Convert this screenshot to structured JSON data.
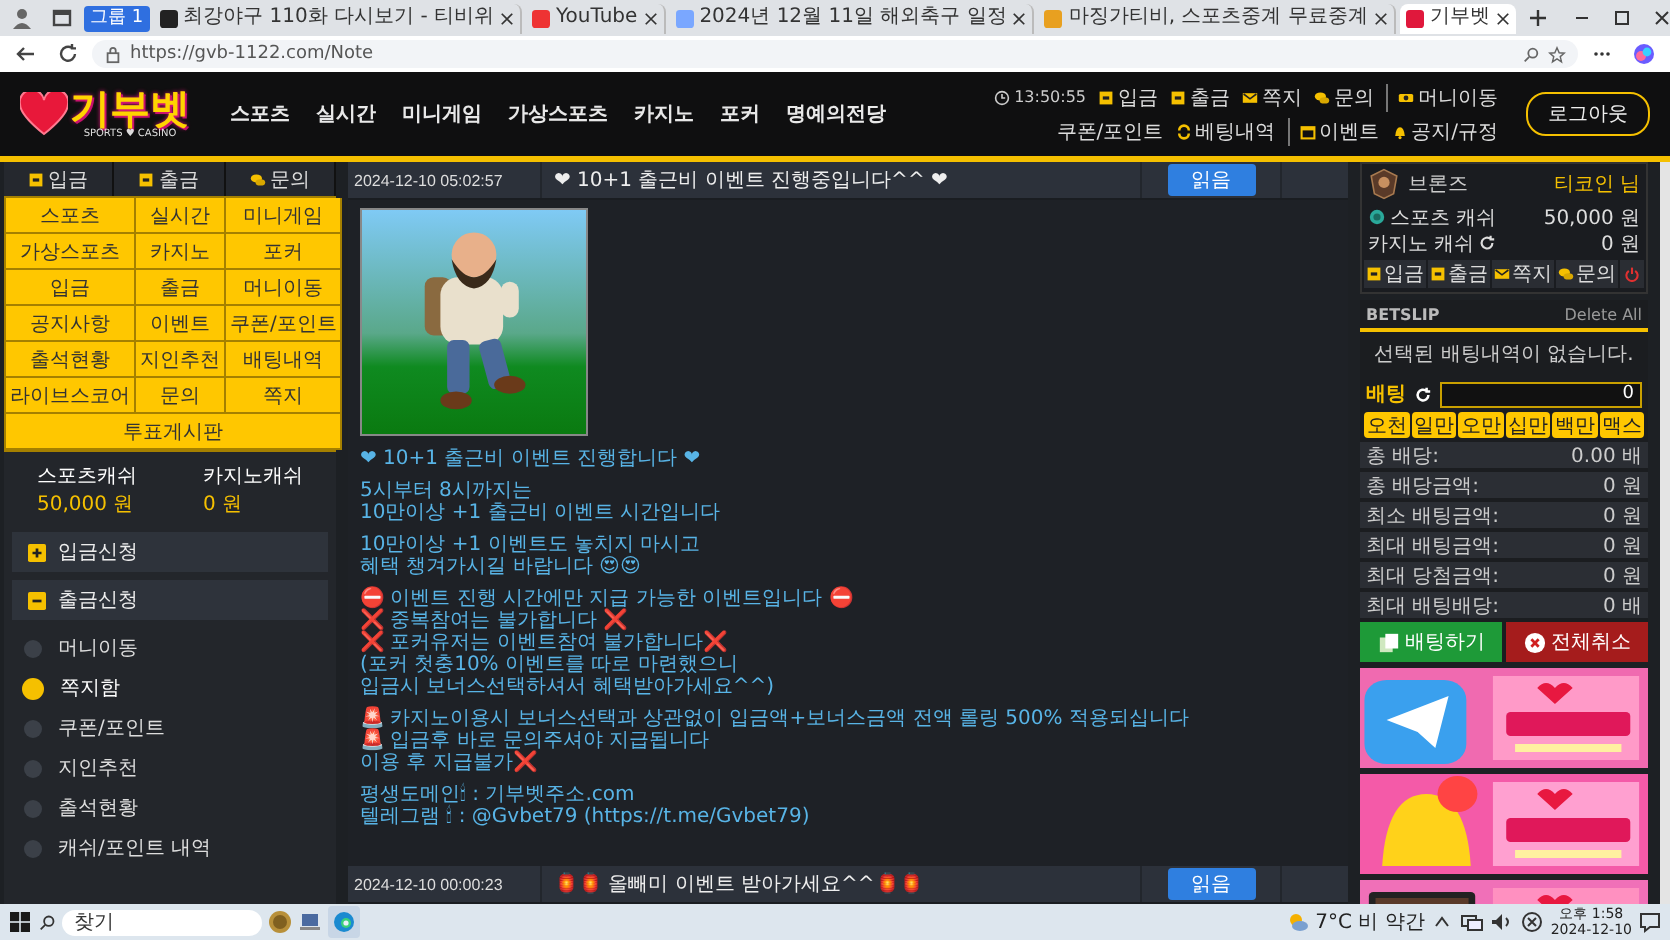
{
  "browser": {
    "group": "그룹 1",
    "tabs": [
      {
        "title": "최강야구 110화 다시보기 - 티비위",
        "selected": false
      },
      {
        "title": "YouTube",
        "selected": false
      },
      {
        "title": "2024년 12월 11일 해외축구 일정",
        "selected": false
      },
      {
        "title": "마징가티비, 스포츠중계 무료중계",
        "selected": false
      },
      {
        "title": "기부벳",
        "selected": true
      }
    ],
    "url": "https://gvb-1122.com/Note"
  },
  "header": {
    "logo": "기부벳",
    "tagline": "SPORTS ♥ CASINO",
    "nav": [
      "스포츠",
      "실시간",
      "미니게임",
      "가상스포츠",
      "카지노",
      "포커",
      "명예의전당"
    ],
    "time": "13:50:55",
    "utility": [
      "입금",
      "출금",
      "쪽지",
      "문의",
      "머니이동",
      "쿠폰/포인트",
      "베팅내역",
      "이벤트",
      "공지/규정"
    ],
    "logout": "로그아웃"
  },
  "sidebar": {
    "quick": [
      "입금",
      "출금",
      "문의"
    ],
    "grid": [
      "스포츠",
      "실시간",
      "미니게임",
      "가상스포츠",
      "카지노",
      "포커",
      "입금",
      "출금",
      "머니이동",
      "공지사항",
      "이벤트",
      "쿠폰/포인트",
      "출석현황",
      "지인추천",
      "배팅내역",
      "라이브스코어",
      "문의",
      "쪽지",
      "투표게시판"
    ],
    "cash": [
      {
        "label": "스포츠캐쉬",
        "amount": "50,000 원"
      },
      {
        "label": "카지노캐쉬",
        "amount": "0 원"
      }
    ],
    "sections": [
      {
        "label": "입금신청",
        "expanded": false
      },
      {
        "label": "출금신청",
        "expanded": true,
        "children": [
          {
            "label": "머니이동",
            "selected": false
          },
          {
            "label": "쪽지함",
            "selected": true
          },
          {
            "label": "쿠폰/포인트",
            "selected": false
          },
          {
            "label": "지인추천",
            "selected": false
          },
          {
            "label": "출석현황",
            "selected": false
          },
          {
            "label": "캐쉬/포인트 내역",
            "selected": false
          }
        ]
      }
    ]
  },
  "notes": [
    {
      "date": "2024-12-10 05:02:57",
      "title": "❤ 10+1 출근비 이벤트 진행중입니다^^ ❤",
      "button": "읽음",
      "expanded": true,
      "image": {
        "kind": "picture"
      },
      "paragraphs": [
        [
          "❤ 10+1 출근비 이벤트 진행합니다 ❤"
        ],
        [
          "5시부터 8시까지는",
          "10만이상 +1 출근비 이벤트 시간입니다"
        ],
        [
          "10만이상 +1 이벤트도 놓치지 마시고",
          "혜택 챙겨가시길 바랍니다 😍😍"
        ],
        [
          "⛔ 이벤트 진행 시간에만 지급 가능한 이벤트입니다 ⛔",
          "❌ 중복참여는 불가합니다 ❌",
          "❌ 포커유저는 이벤트참여 불가합니다❌",
          "(포커 첫충10% 이벤트를 따로 마련했으니",
          "입금시 보너스선택하셔서 혜택받아가세요^^)"
        ],
        [
          "🚨 카지노이용시 보너스선택과 상관없이 입금액+보너스금액 전액 롤링 500% 적용되십니다",
          "🚨 입금후 바로 문의주셔야 지급됩니다",
          "이용 후 지급불가❌"
        ],
        [
          "평생도메인🕯 : 기부벳주소.com",
          "텔레그램 🕯 : @Gvbet79 (https://t.me/Gvbet79)"
        ]
      ]
    },
    {
      "date": "2024-12-10 00:00:23",
      "title": "🏮🏮 올빼미 이벤트 받아가세요^^🏮🏮",
      "button": "읽음",
      "expanded": false
    }
  ],
  "account": {
    "rank": "브론즈",
    "user": "티코인 님",
    "cash": [
      {
        "label": "스포츠 캐쉬",
        "amount": "50,000 원"
      },
      {
        "label": "카지노 캐쉬",
        "amount": "0 원"
      }
    ],
    "buttons": [
      "입금",
      "출금",
      "쪽지",
      "문의"
    ]
  },
  "betslip": {
    "title": "BETSLIP",
    "delete": "Delete All",
    "empty": "선택된 배팅내역이 없습니다.",
    "bet_label": "배팅",
    "amount": "0",
    "chips": [
      "오천",
      "일만",
      "오만",
      "십만",
      "백만",
      "맥스"
    ],
    "stats": [
      {
        "label": "총 배당:",
        "value": "0.00 배"
      },
      {
        "label": "총 배당금액:",
        "value": "0 원"
      },
      {
        "label": "최소 배팅금액:",
        "value": "0 원"
      },
      {
        "label": "최대 배팅금액:",
        "value": "0 원"
      },
      {
        "label": "최대 당첨금액:",
        "value": "0 원"
      },
      {
        "label": "최대 배팅배당:",
        "value": "0 배"
      }
    ],
    "place": "배팅하기",
    "cancel": "전체취소"
  },
  "banners": [
    {
      "kind": "picture"
    },
    {
      "kind": "picture"
    },
    {
      "kind": "picture"
    }
  ],
  "taskbar": {
    "placeholder": "찾기",
    "weather": "7°C 비 약간",
    "time": "오후 1:58",
    "date": "2024-12-10"
  }
}
